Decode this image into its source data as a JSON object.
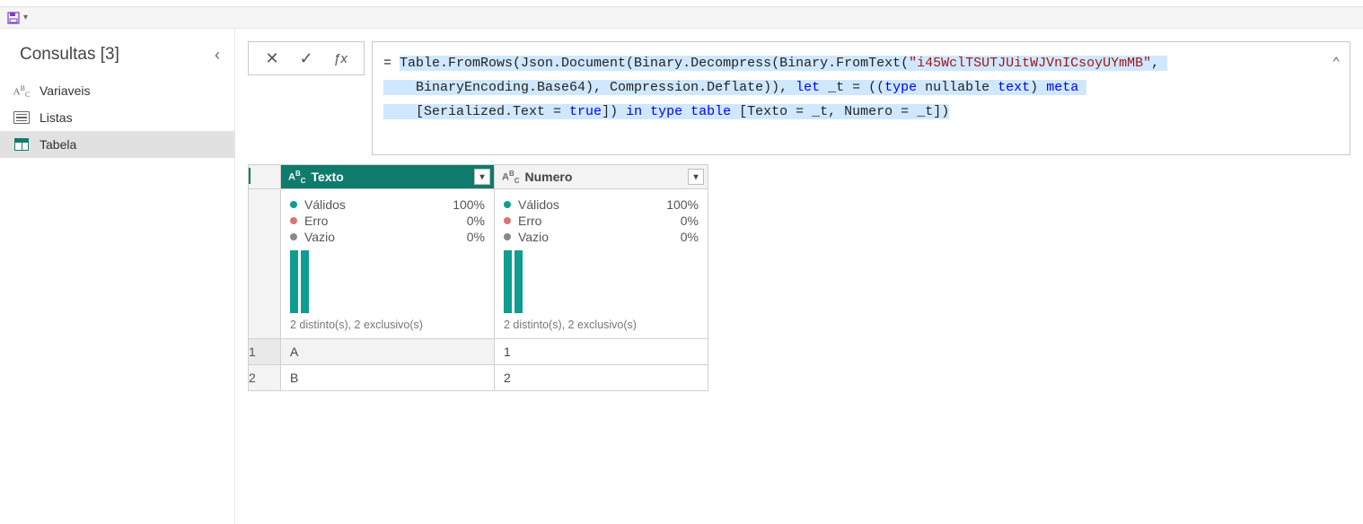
{
  "qat": {
    "dropdown_glyph": "▾"
  },
  "sidebar": {
    "title": "Consultas [3]",
    "items": [
      {
        "label": "Variaveis",
        "type": "abc"
      },
      {
        "label": "Listas",
        "type": "list"
      },
      {
        "label": "Tabela",
        "type": "table",
        "selected": true
      }
    ]
  },
  "formula": {
    "prefix": "= ",
    "tokens": [
      {
        "t": "Table.FromRows(Json.Document(Binary.Decompress(Binary.FromText(",
        "hl": true
      },
      {
        "t": "\"i45WclTSUTJUitWJVnICsoyUYmMB\"",
        "hl": true,
        "cls": "kw-str"
      },
      {
        "t": ", ",
        "hl": true
      },
      {
        "t": "\n    BinaryEncoding.Base64), Compression.Deflate)), ",
        "hl": true
      },
      {
        "t": "let",
        "hl": true,
        "cls": "kw-blue"
      },
      {
        "t": " _t = ((",
        "hl": true
      },
      {
        "t": "type",
        "hl": true,
        "cls": "kw-blue"
      },
      {
        "t": " nullable ",
        "hl": true
      },
      {
        "t": "text",
        "hl": true,
        "cls": "kw-blue"
      },
      {
        "t": ") ",
        "hl": true
      },
      {
        "t": "meta",
        "hl": true,
        "cls": "kw-blue"
      },
      {
        "t": " ",
        "hl": true
      },
      {
        "t": "\n    [Serialized.Text = ",
        "hl": true
      },
      {
        "t": "true",
        "hl": true,
        "cls": "kw-blue"
      },
      {
        "t": "]) ",
        "hl": true
      },
      {
        "t": "in",
        "hl": true,
        "cls": "kw-blue"
      },
      {
        "t": " ",
        "hl": true
      },
      {
        "t": "type",
        "hl": true,
        "cls": "kw-blue"
      },
      {
        "t": " ",
        "hl": true
      },
      {
        "t": "table",
        "hl": true,
        "cls": "kw-blue"
      },
      {
        "t": " [Texto = _t, Numero = _t])",
        "hl": true
      }
    ]
  },
  "table": {
    "columns": [
      {
        "name": "Texto",
        "active": true
      },
      {
        "name": "Numero",
        "active": false
      }
    ],
    "quality_labels": {
      "valid": "Válidos",
      "error": "Erro",
      "empty": "Vazio"
    },
    "quality": [
      {
        "valid": "100%",
        "error": "0%",
        "empty": "0%",
        "dist": "2 distinto(s), 2 exclusivo(s)"
      },
      {
        "valid": "100%",
        "error": "0%",
        "empty": "0%",
        "dist": "2 distinto(s), 2 exclusivo(s)"
      }
    ],
    "rows": [
      {
        "n": "1",
        "cells": [
          "A",
          "1"
        ]
      },
      {
        "n": "2",
        "cells": [
          "B",
          "2"
        ]
      }
    ]
  }
}
